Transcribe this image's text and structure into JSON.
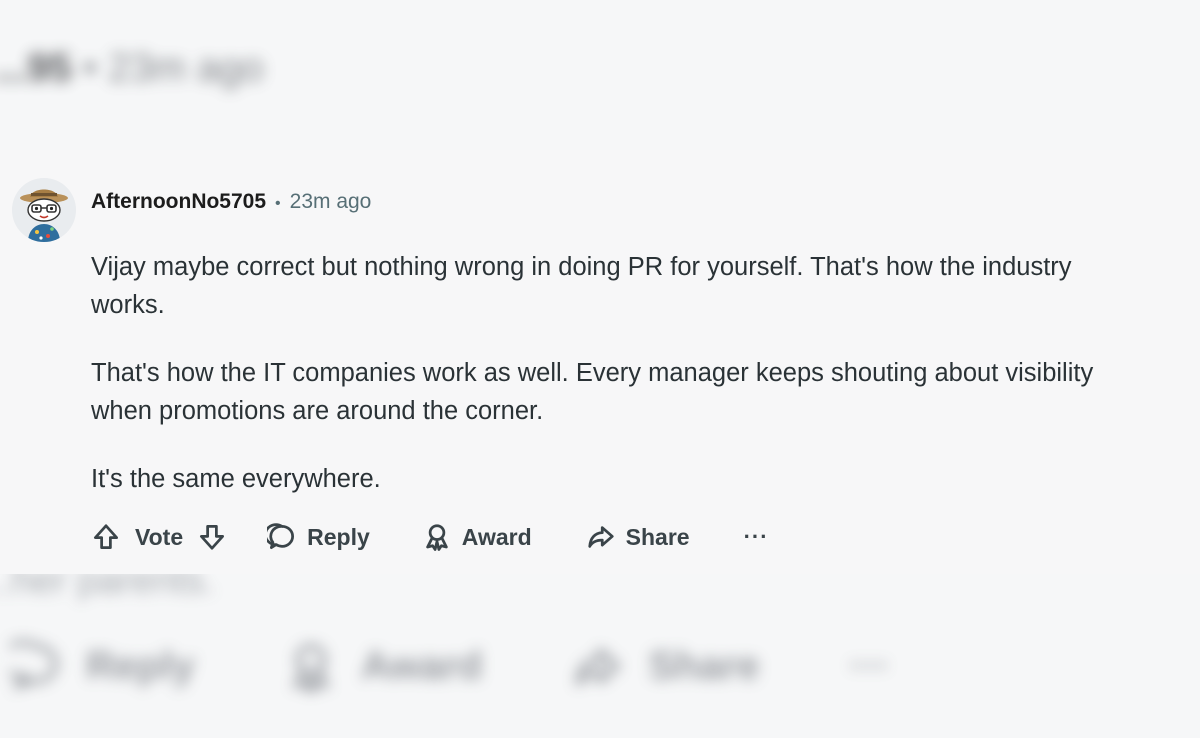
{
  "background": {
    "top_user": "...95",
    "top_sep": "•",
    "top_time": "23m ago",
    "bottom_text": "...her parents.",
    "actions": [
      "Reply",
      "Award",
      "Share",
      "···"
    ]
  },
  "comment": {
    "username": "AfternoonNo5705",
    "separator": "•",
    "time": "23m ago",
    "paragraphs": [
      "Vijay maybe correct but nothing wrong in doing PR for yourself. That's how the industry works.",
      "That's how the IT companies work as well. Every manager keeps shouting about visibility when promotions are around the corner.",
      "It's the same everywhere."
    ],
    "actions": {
      "vote": "Vote",
      "reply": "Reply",
      "award": "Award",
      "share": "Share",
      "more": "···"
    }
  },
  "icons": {
    "upvote": "arrow-up-icon",
    "downvote": "arrow-down-icon",
    "reply": "speech-bubble-icon",
    "award": "award-ribbon-icon",
    "share": "share-arrow-icon",
    "more": "ellipsis-icon"
  }
}
